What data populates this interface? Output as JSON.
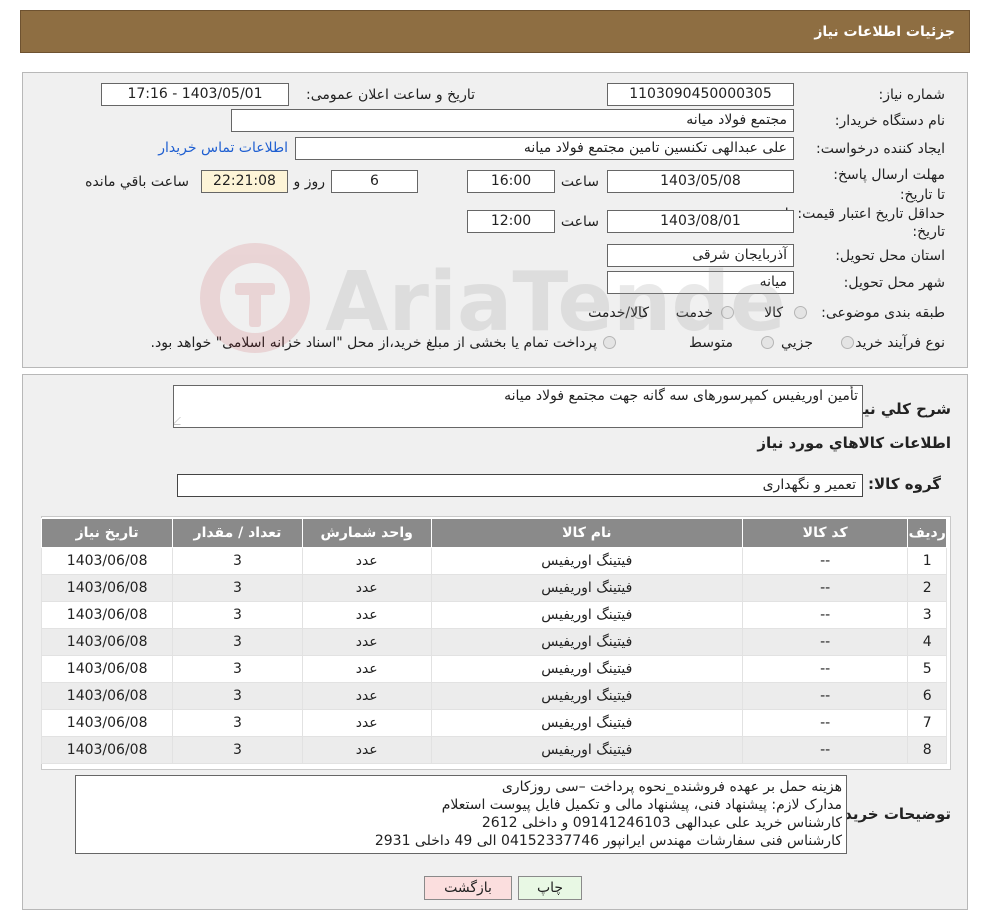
{
  "header": {
    "title": "جزئیات اطلاعات نیاز"
  },
  "info": {
    "need_number_label": "شماره نیاز:",
    "need_number": "1103090450000305",
    "announce_label": "تاریخ و ساعت اعلان عمومی:",
    "announce_value": "1403/05/01 - 17:16",
    "buyer_org_label": "نام دستگاه خریدار:",
    "buyer_org": "مجتمع فولاد میانه",
    "creator_label": "ایجاد کننده درخواست:",
    "creator": "علی عبدالهی تکنسین تامین مجتمع فولاد میانه",
    "contact_link": "اطلاعات تماس خریدار",
    "reply_deadline_label": "مهلت ارسال پاسخ: تا تاریخ:",
    "reply_date": "1403/05/08",
    "time_label": "ساعت",
    "reply_time": "16:00",
    "days": "6",
    "days_and": "روز و",
    "remaining_time": "22:21:08",
    "remaining_label": "ساعت باقي مانده",
    "price_validity_label": "حداقل تاریخ اعتبار قیمت: تا تاریخ:",
    "price_date": "1403/08/01",
    "price_time": "12:00",
    "province_label": "استان محل تحویل:",
    "province": "آذربایجان شرقی",
    "city_label": "شهر محل تحویل:",
    "city": "میانه",
    "category_label": "طبقه بندی موضوعی:",
    "category_options": [
      "کالا",
      "خدمت",
      "کالا/خدمت"
    ],
    "process_label": "نوع فرآیند خرید :",
    "process_options": [
      "جزيي",
      "متوسط"
    ],
    "payment_note": "پرداخت تمام یا بخشی از مبلغ خرید،از محل \"اسناد خزانه اسلامی\" خواهد بود."
  },
  "items_section": {
    "summary_label": "شرح كلي نياز:",
    "summary": "تأمین اوریفیس کمپرسورهای سه گانه جهت مجتمع فولاد میانه",
    "goods_heading": "اطلاعات كالاهاي مورد نياز",
    "group_label": "گروه كالا:",
    "group_value": "تعمیر و نگهداری",
    "table": {
      "headers": [
        "رديف",
        "کد کالا",
        "نام کالا",
        "واحد شمارش",
        "تعداد / مقدار",
        "تاریخ نیاز"
      ],
      "rows": [
        [
          "1",
          "--",
          "فیتینگ اوریفیس",
          "عدد",
          "3",
          "1403/06/08"
        ],
        [
          "2",
          "--",
          "فیتینگ اوریفیس",
          "عدد",
          "3",
          "1403/06/08"
        ],
        [
          "3",
          "--",
          "فیتینگ اوریفیس",
          "عدد",
          "3",
          "1403/06/08"
        ],
        [
          "4",
          "--",
          "فیتینگ اوریفیس",
          "عدد",
          "3",
          "1403/06/08"
        ],
        [
          "5",
          "--",
          "فیتینگ اوریفیس",
          "عدد",
          "3",
          "1403/06/08"
        ],
        [
          "6",
          "--",
          "فیتینگ اوریفیس",
          "عدد",
          "3",
          "1403/06/08"
        ],
        [
          "7",
          "--",
          "فیتینگ اوریفیس",
          "عدد",
          "3",
          "1403/06/08"
        ],
        [
          "8",
          "--",
          "فیتینگ اوریفیس",
          "عدد",
          "3",
          "1403/06/08"
        ]
      ]
    },
    "buyer_notes_label": "توضیحات خریدار:",
    "buyer_notes": [
      "هزینه حمل بر عهده فروشنده_نحوه پرداخت –سی روزکاری",
      "مدارک لازم: پیشنهاد فنی، پیشنهاد مالی و تکمیل فایل پیوست استعلام",
      "کارشناس خرید علی عبدالهی 09141246103 و داخلی 2612",
      "کارشناس فنی سفارشات مهندس ایرانپور 04152337746 الی 49 داخلی 2931"
    ]
  },
  "buttons": {
    "print": "چاپ",
    "back": "بازگشت"
  },
  "watermark_text": "AriaTender.neT",
  "colors": {
    "header": "#8e6e42",
    "table_header": "#8a8a8a",
    "link": "#1f5fd1",
    "highlight": "#fdf4d7"
  }
}
